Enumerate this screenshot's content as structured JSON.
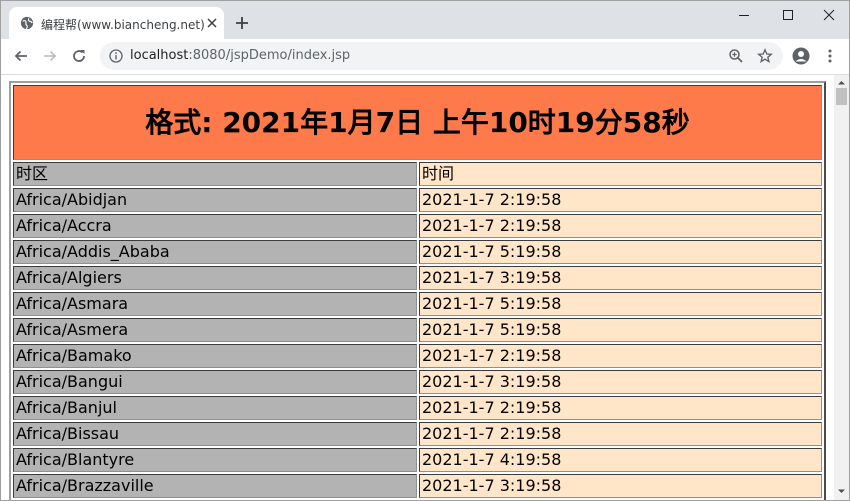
{
  "browser": {
    "tab_title": "编程帮(www.biancheng.net)",
    "url_host": "localhost",
    "url_path": ":8080/jspDemo/index.jsp"
  },
  "page": {
    "heading": "格式: 2021年1月7日 上午10时19分58秒",
    "header_zone": "时区",
    "header_time": "时间",
    "rows": [
      {
        "zone": "Africa/Abidjan",
        "time": "2021-1-7 2:19:58"
      },
      {
        "zone": "Africa/Accra",
        "time": "2021-1-7 2:19:58"
      },
      {
        "zone": "Africa/Addis_Ababa",
        "time": "2021-1-7 5:19:58"
      },
      {
        "zone": "Africa/Algiers",
        "time": "2021-1-7 3:19:58"
      },
      {
        "zone": "Africa/Asmara",
        "time": "2021-1-7 5:19:58"
      },
      {
        "zone": "Africa/Asmera",
        "time": "2021-1-7 5:19:58"
      },
      {
        "zone": "Africa/Bamako",
        "time": "2021-1-7 2:19:58"
      },
      {
        "zone": "Africa/Bangui",
        "time": "2021-1-7 3:19:58"
      },
      {
        "zone": "Africa/Banjul",
        "time": "2021-1-7 2:19:58"
      },
      {
        "zone": "Africa/Bissau",
        "time": "2021-1-7 2:19:58"
      },
      {
        "zone": "Africa/Blantyre",
        "time": "2021-1-7 4:19:58"
      },
      {
        "zone": "Africa/Brazzaville",
        "time": "2021-1-7 3:19:58"
      }
    ]
  },
  "colors": {
    "heading_bg": "#ff7a4a",
    "zone_bg": "#b3b3b3",
    "time_bg": "#ffe6c9",
    "tabstrip_bg": "#dee1e6"
  },
  "icons": {
    "favicon": "globe-icon",
    "tab_close": "close-icon",
    "new_tab": "plus-icon",
    "back": "arrow-left-icon",
    "forward": "arrow-right-icon",
    "reload": "reload-icon",
    "site_info": "info-icon",
    "zoom": "zoom-icon",
    "bookmark": "star-icon",
    "profile": "account-icon",
    "menu": "kebab-menu-icon"
  }
}
